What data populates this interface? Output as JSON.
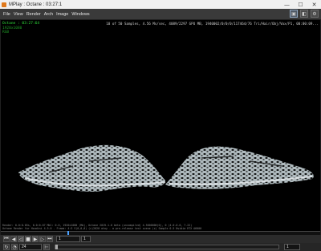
{
  "window": {
    "title": "MPlay : Octane : 03:27:1",
    "icon": "mplay-icon",
    "controls": {
      "minimize": "—",
      "maximize": "☐",
      "close": "✕"
    }
  },
  "menu": {
    "items": [
      "File",
      "View",
      "Render",
      "Arch",
      "Image",
      "Windows"
    ]
  },
  "viewport": {
    "overlay_left_title": "Octane : 03:27:64",
    "overlay_left_sub1": "1920x1080",
    "overlay_left_sub2": "RGB",
    "overlay_right": "10 of 50 Samples, 4.56 Ms/sec, 4089/2297 GPU MB, 1940002/0/0/0/117464/76 Tri/Hair/Obj/Vox/P1, 00:00:09...",
    "overlay_bottom_1": "Render: 0.0:0.05s, 0.0:0.07 Mbl: 0.0, 1920x1080 (Mb), Octane 2019.1.0 beta (uncompiled) 4.5000000(0), 0 (4.0.0.0, 7.22)",
    "overlay_bottom_2": "Octane Render for Houdini 4.5.0 - Frame: 4:3 S(0,0,0) (c)2020 otoy - a pre-release test scene (c) Sample 0.5 Nvidia RTX A6000"
  },
  "playbar": {
    "frame": "1",
    "step": "1",
    "fps": "24",
    "end_frame": "1",
    "colors": {
      "accent": "#4aa0ff",
      "overlay_green": "#2fe03a"
    }
  }
}
